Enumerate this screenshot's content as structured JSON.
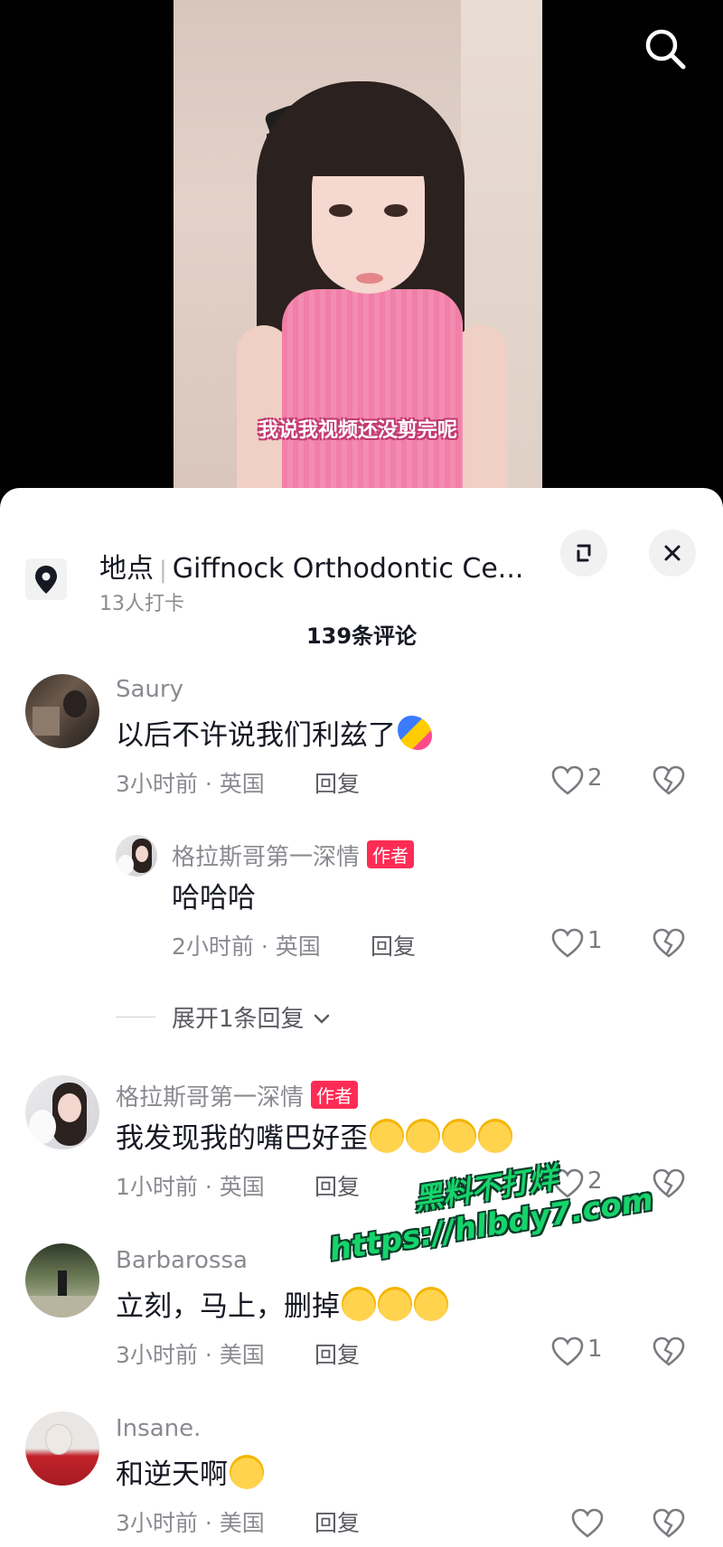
{
  "video": {
    "subtitle": "我说我视频还没剪完呢"
  },
  "location": {
    "label": "地点",
    "place_name": "Giffnock Orthodontic Ce...",
    "checkins": "13人打卡"
  },
  "comments_header": {
    "count_label": "139条评论"
  },
  "comments": [
    {
      "user": "Saury",
      "text": "以后不许说我们利兹了",
      "time_location": "3小时前 · 英国",
      "reply_label": "回复",
      "likes": "2",
      "emojis": [
        "bird"
      ]
    },
    {
      "user": "格拉斯哥第一深情",
      "author_badge": "作者",
      "text": "哈哈哈",
      "time_location": "2小时前 · 英国",
      "reply_label": "回复",
      "likes": "1",
      "is_reply": true
    },
    {
      "user": "格拉斯哥第一深情",
      "author_badge": "作者",
      "text": "我发现我的嘴巴好歪",
      "time_location": "1小时前 · 英国",
      "reply_label": "回复",
      "likes": "2",
      "emojis": [
        "sweat",
        "sweat",
        "sweat",
        "sweat"
      ]
    },
    {
      "user": "Barbarossa",
      "text": "立刻，马上，删掉",
      "time_location": "3小时前 · 美国",
      "reply_label": "回复",
      "likes": "1",
      "emojis": [
        "cry",
        "cry",
        "cry"
      ]
    },
    {
      "user": "Insane.",
      "text": "和逆天啊",
      "time_location": "3小时前 · 美国",
      "reply_label": "回复",
      "likes": "",
      "emojis": [
        "sob"
      ]
    }
  ],
  "expand_replies": {
    "label": "展开1条回复"
  },
  "watermark": {
    "line1": "黑料不打烊",
    "line2": "https://hlbdy7.com"
  },
  "colors": {
    "author_badge": "#fe2c55",
    "sweater_pink": "#f48cb1",
    "watermark_green": "#16d46b"
  },
  "icons": [
    "search-icon",
    "location-pin-icon",
    "expand-icon",
    "close-icon",
    "heart-icon",
    "dislike-icon",
    "chevron-down-icon"
  ]
}
